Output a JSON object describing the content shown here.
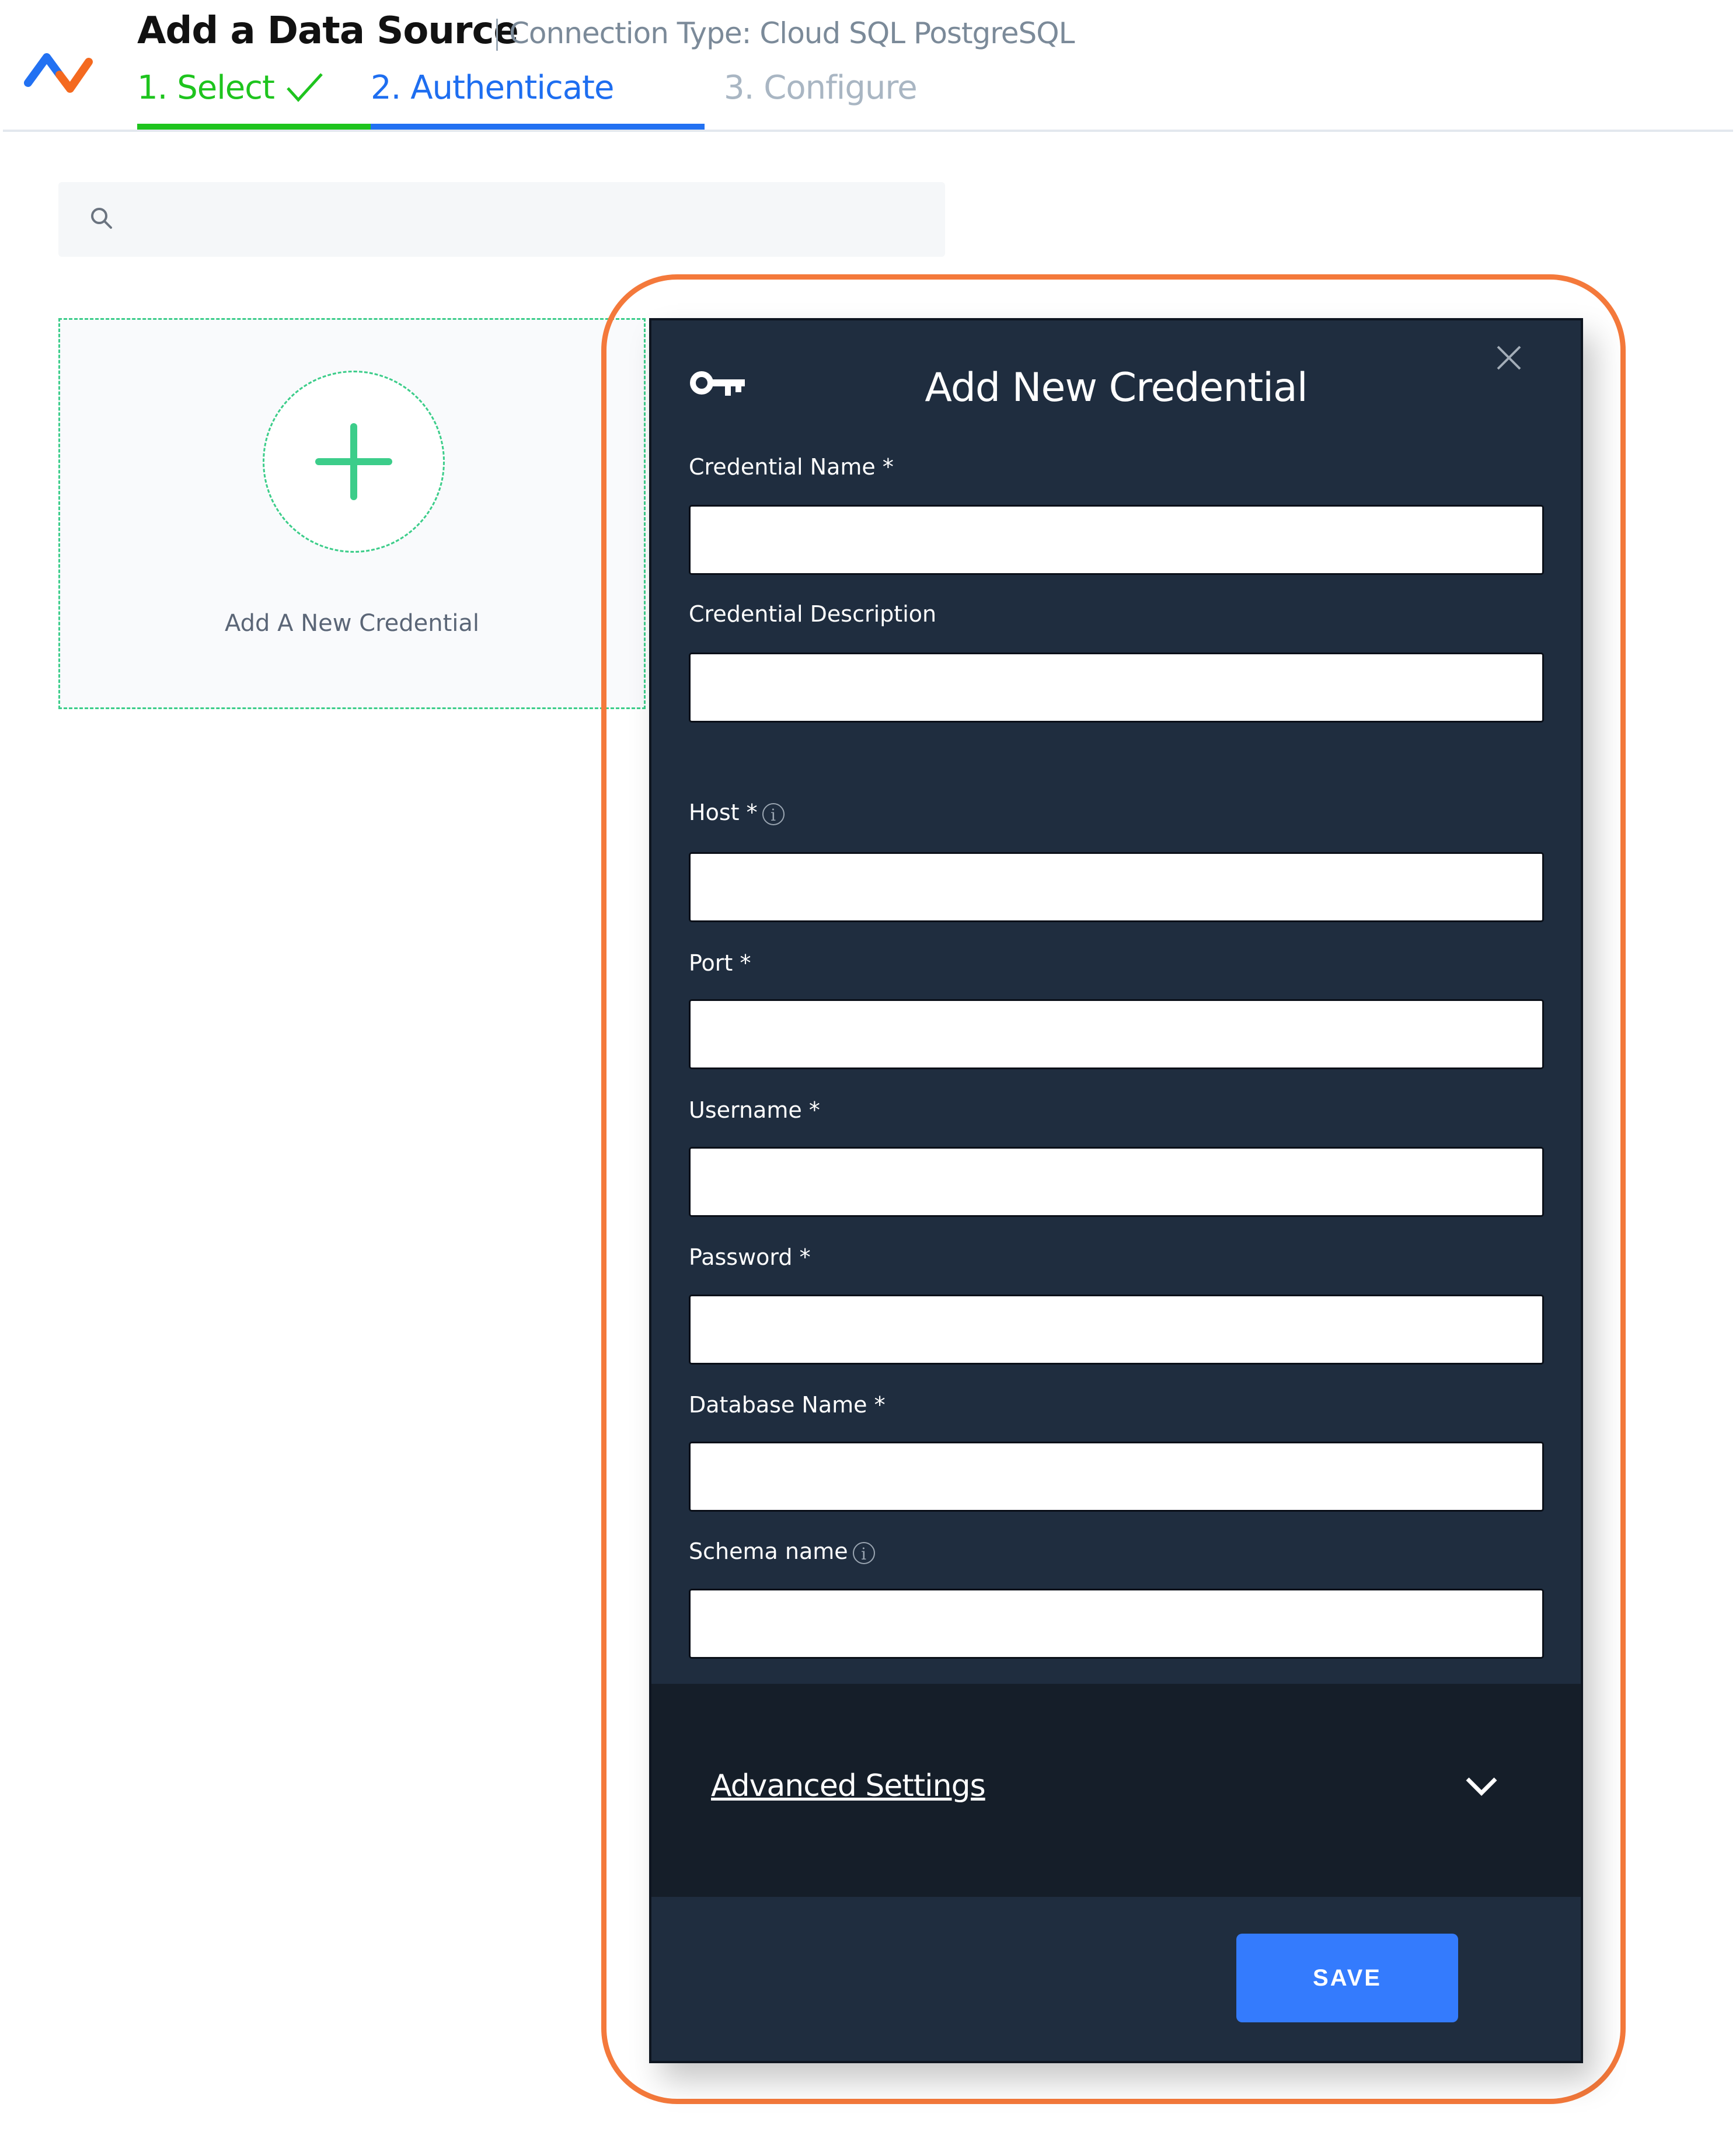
{
  "header": {
    "title": "Add a Data Source",
    "connection_type": "Connection Type: Cloud SQL PostgreSQL",
    "steps": [
      {
        "label": "1. Select",
        "state": "complete",
        "color": "#1ec41e"
      },
      {
        "label": "2. Authenticate",
        "state": "active",
        "color": "#1e6ef0"
      },
      {
        "label": "3. Configure",
        "state": "pending",
        "color": "#a9b6c3"
      }
    ]
  },
  "search": {
    "placeholder": "",
    "value": ""
  },
  "add_card": {
    "label": "Add A New Credential"
  },
  "modal": {
    "title": "Add New Credential",
    "fields": [
      {
        "label": "Credential Name",
        "required": true,
        "info": false,
        "value": ""
      },
      {
        "label": "Credential Description",
        "required": false,
        "info": false,
        "value": ""
      },
      {
        "label": "Host",
        "required": true,
        "info": true,
        "value": ""
      },
      {
        "label": "Port",
        "required": true,
        "info": false,
        "value": ""
      },
      {
        "label": "Username",
        "required": true,
        "info": false,
        "value": ""
      },
      {
        "label": "Password",
        "required": true,
        "info": false,
        "value": ""
      },
      {
        "label": "Database Name",
        "required": true,
        "info": false,
        "value": ""
      },
      {
        "label": "Schema name",
        "required": false,
        "info": true,
        "value": ""
      }
    ],
    "advanced_settings_label": "Advanced Settings",
    "save_label": "SAVE"
  },
  "colors": {
    "accent_blue": "#347bfd",
    "success_green": "#1ec41e",
    "highlight_orange": "#f4793b",
    "modal_bg": "#1f2d3f"
  }
}
